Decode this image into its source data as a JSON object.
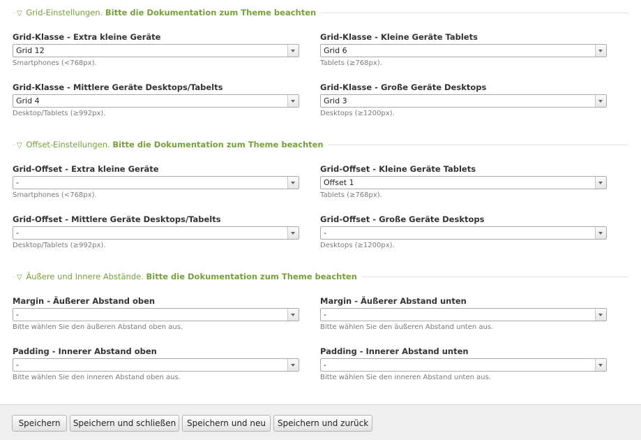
{
  "sections": [
    {
      "legend_prefix": "Grid-Einstellungen.",
      "legend_strong": "Bitte die Dokumentation zum Theme beachten",
      "fields": [
        {
          "label": "Grid-Klasse - Extra kleine Geräte",
          "value": "Grid 12",
          "help": "Smartphones (<768px)."
        },
        {
          "label": "Grid-Klasse - Kleine Geräte Tablets",
          "value": "Grid 6",
          "help": "Tablets (≥768px)."
        },
        {
          "label": "Grid-Klasse - Mittlere Geräte Desktops/Tabelts",
          "value": "Grid 4",
          "help": "Desktop/Tablets (≥992px)."
        },
        {
          "label": "Grid-Klasse - Große Geräte Desktops",
          "value": "Grid 3",
          "help": "Desktops (≥1200px)."
        }
      ]
    },
    {
      "legend_prefix": "Offset-Einstellungen.",
      "legend_strong": "Bitte die Dokumentation zum Theme beachten",
      "fields": [
        {
          "label": "Grid-Offset - Extra kleine Geräte",
          "value": "-",
          "help": "Smartphones (<768px)."
        },
        {
          "label": "Grid-Offset - Kleine Geräte Tablets",
          "value": "Offset 1",
          "help": "Tablets (≥768px)."
        },
        {
          "label": "Grid-Offset - Mittlere Geräte Desktops/Tabelts",
          "value": "-",
          "help": "Desktop/Tablets (≥992px)."
        },
        {
          "label": "Grid-Offset - Große Geräte Desktops",
          "value": "-",
          "help": "Desktops (≥1200px)."
        }
      ]
    },
    {
      "legend_prefix": "Äußere und Innere Abstände.",
      "legend_strong": "Bitte die Dokumentation zum Theme beachten",
      "fields": [
        {
          "label": "Margin - Äußerer Abstand oben",
          "value": "-",
          "help": "Bitte wählen Sie den äußeren Abstand oben aus."
        },
        {
          "label": "Margin - Äußerer Abstand unten",
          "value": "-",
          "help": "Bitte wählen Sie den äußeren Abstand unten aus."
        },
        {
          "label": "Padding - Innerer Abstand oben",
          "value": "-",
          "help": "Bitte wählen Sie den inneren Abstand oben aus."
        },
        {
          "label": "Padding - Innerer Abstand unten",
          "value": "-",
          "help": "Bitte wählen Sie den inneren Abstand unten aus."
        }
      ]
    }
  ],
  "footer": {
    "buttons": [
      "Speichern",
      "Speichern und schließen",
      "Speichern und neu",
      "Speichern und zurück"
    ]
  },
  "colors": {
    "legend_green": "#76a03a",
    "footer_bg": "#efefef"
  }
}
